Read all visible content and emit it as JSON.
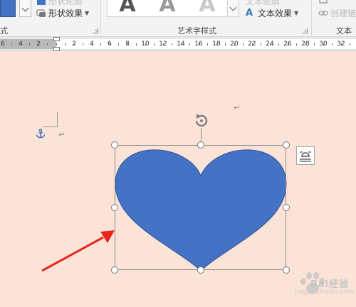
{
  "ribbon": {
    "shape_styles_group_label": "式",
    "shape_outline_label": "形状轮廓",
    "shape_effects_label": "形状效果",
    "wordart_sample_glyph": "A",
    "wordart_styles_group_label": "艺术字样式",
    "text_outline_label": "文本轮廓",
    "text_effects_label": "文本效果",
    "text_group_label": "文本",
    "create_link_label": "创建链接"
  },
  "ruler": {
    "ticks": [
      "6",
      "4",
      "2",
      "2",
      "4",
      "6",
      "8",
      "10",
      "12",
      "14",
      "16",
      "18",
      "20",
      "22",
      "24",
      "26",
      "28",
      "30",
      "32"
    ]
  },
  "document": {
    "paragraph_mark": "↵",
    "shape": "heart",
    "shape_fill_color": "#4472c4",
    "shape_outline_color": "#2f5597",
    "page_background_color": "#fbe3d7",
    "annotation_arrow_color": "#e8251c"
  },
  "watermark": {
    "brand_text": "Bai经验",
    "url_text": "jingyan.baidu.com"
  }
}
